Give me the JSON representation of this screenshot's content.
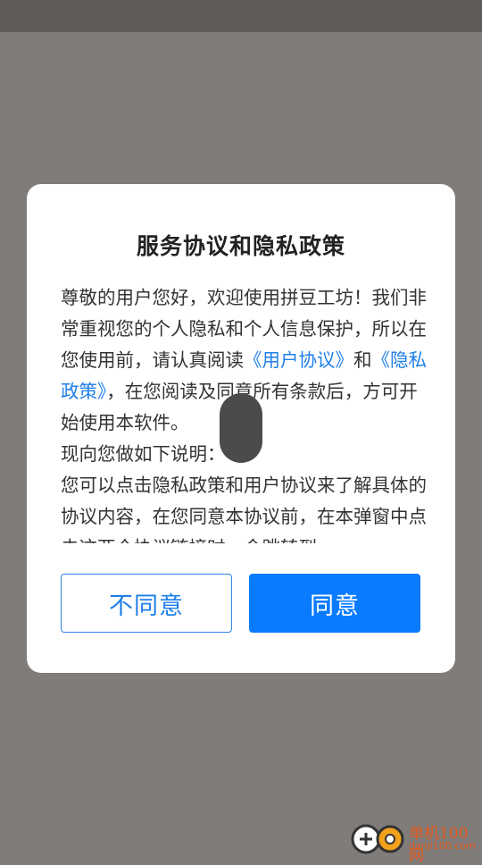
{
  "dialog": {
    "title": "服务协议和隐私政策",
    "p1_a": "尊敬的用户您好，欢迎使用拼豆工坊！我们非常重视您的个人隐私和个人信息保护，所以在您使用前，请认真阅读",
    "link_user_agreement": "《用户协议》",
    "p1_and": "和",
    "link_privacy_policy": "《隐私政策》",
    "p1_b": "，在您阅读及同意所有条款后，方可开始使用本软件。",
    "p2": "现向您做如下说明：",
    "p3": "您可以点击隐私政策和用户协议来了解具体的协议内容，在您同意本协议前，在本弹窗中点击这两个协议链接时，会跳转到",
    "btn_disagree": "不同意",
    "btn_agree": "同意"
  },
  "watermark": {
    "name": "单机100网",
    "url": "danji100.com"
  },
  "colors": {
    "overlay": "#7f7c79",
    "link": "#1f7fe8",
    "agree_bg": "#0a7bff"
  }
}
